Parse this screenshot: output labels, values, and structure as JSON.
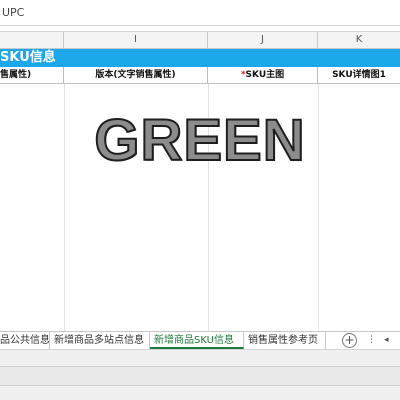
{
  "formula_bar": {
    "value": "UPC"
  },
  "columns": {
    "i": "I",
    "j": "J",
    "k": "K"
  },
  "section_title": "SKU信息",
  "headers": {
    "col_h": "售属性)",
    "col_i": "版本(文字销售属性)",
    "col_j_required": "*",
    "col_j": "SKU主图",
    "col_k": "SKU详情图1"
  },
  "watermark": "GREEN",
  "sheet_tabs": [
    {
      "label": "品公共信息"
    },
    {
      "label": "新增商品多站点信息"
    },
    {
      "label": "新增商品SKU信息",
      "active": true
    },
    {
      "label": "销售属性参考页"
    }
  ],
  "tab_controls": {
    "add": "+",
    "more": "⋮",
    "arrow": "◂"
  },
  "colors": {
    "title_bg": "#1ba7e8",
    "active_tab": "#1e7a3c",
    "required": "#e0201b"
  }
}
